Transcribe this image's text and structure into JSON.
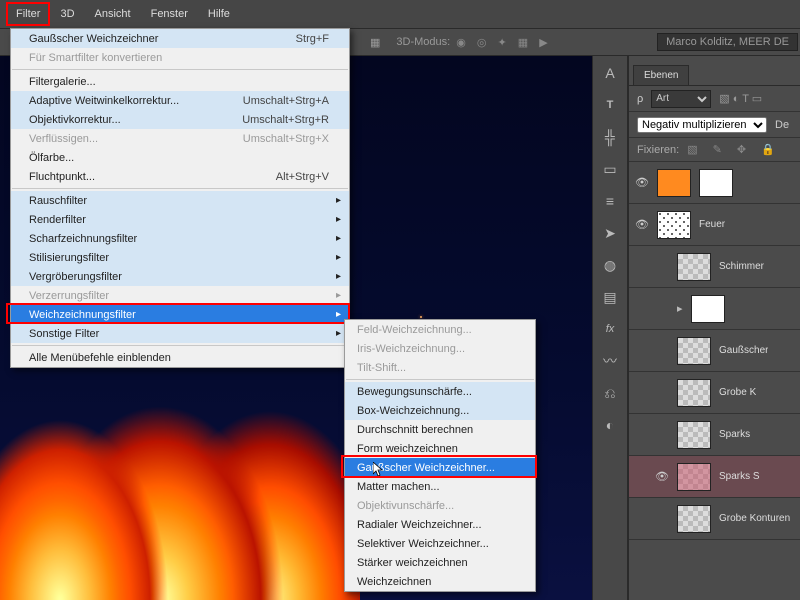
{
  "menubar": {
    "items": [
      "Filter",
      "3D",
      "Ansicht",
      "Fenster",
      "Hilfe"
    ],
    "active_index": 0
  },
  "topstrip": {
    "mode_label": "3D-Modus:",
    "user_tag": "Marco Kolditz, MEER DE"
  },
  "dropdown1": {
    "items": [
      {
        "label": "Gaußscher Weichzeichner",
        "shortcut": "Strg+F",
        "shade": true
      },
      {
        "label": "Für Smartfilter konvertieren",
        "disabled": true
      },
      {
        "sep": true
      },
      {
        "label": "Filtergalerie...",
        "shade": false
      },
      {
        "label": "Adaptive Weitwinkelkorrektur...",
        "shortcut": "Umschalt+Strg+A",
        "shade": true
      },
      {
        "label": "Objektivkorrektur...",
        "shortcut": "Umschalt+Strg+R",
        "shade": true
      },
      {
        "label": "Verflüssigen...",
        "shortcut": "Umschalt+Strg+X",
        "disabled": true
      },
      {
        "label": "Ölfarbe..."
      },
      {
        "label": "Fluchtpunkt...",
        "shortcut": "Alt+Strg+V"
      },
      {
        "sep": true
      },
      {
        "label": "Rauschfilter",
        "shade": true,
        "submenu": true
      },
      {
        "label": "Renderfilter",
        "shade": true,
        "submenu": true
      },
      {
        "label": "Scharfzeichnungsfilter",
        "shade": true,
        "submenu": true
      },
      {
        "label": "Stilisierungsfilter",
        "shade": true,
        "submenu": true
      },
      {
        "label": "Vergröberungsfilter",
        "shade": true,
        "submenu": true
      },
      {
        "label": "Verzerrungsfilter",
        "disabled": true,
        "submenu": true
      },
      {
        "label": "Weichzeichnungsfilter",
        "shade": true,
        "submenu": true,
        "selected": true,
        "highlight": true
      },
      {
        "label": "Sonstige Filter",
        "shade": true,
        "submenu": true
      },
      {
        "sep": true
      },
      {
        "label": "Alle Menübefehle einblenden"
      }
    ]
  },
  "dropdown2": {
    "items": [
      {
        "label": "Feld-Weichzeichnung...",
        "disabled": true
      },
      {
        "label": "Iris-Weichzeichnung...",
        "disabled": true
      },
      {
        "label": "Tilt-Shift...",
        "disabled": true
      },
      {
        "sep": true
      },
      {
        "label": "Bewegungsunschärfe...",
        "shade": true
      },
      {
        "label": "Box-Weichzeichnung...",
        "shade": true
      },
      {
        "label": "Durchschnitt berechnen"
      },
      {
        "label": "Form weichzeichnen"
      },
      {
        "label": "Gaußscher Weichzeichner...",
        "shade": true,
        "selected": true,
        "highlight": true
      },
      {
        "label": "Matter machen..."
      },
      {
        "label": "Objektivunschärfe...",
        "disabled": true
      },
      {
        "label": "Radialer Weichzeichner..."
      },
      {
        "label": "Selektiver Weichzeichner..."
      },
      {
        "label": "Stärker weichzeichnen"
      },
      {
        "label": "Weichzeichnen"
      }
    ]
  },
  "tools": [
    "A",
    "T",
    "ruler",
    "slice",
    "guide",
    "arrow",
    "palette",
    "gradient",
    "fx",
    "brush",
    "clone",
    "dodge"
  ],
  "layers_panel": {
    "tab": "Ebenen",
    "kind": "Art",
    "blend": "Negativ multiplizieren",
    "label_pin": "Fixieren:",
    "label_dev": "De",
    "layers": [
      {
        "eye": true,
        "indent": 0,
        "thumb": "orange",
        "mask": true,
        "name": ""
      },
      {
        "eye": true,
        "indent": 0,
        "thumb": "white-sparks",
        "mask": false,
        "name": "Feuer"
      },
      {
        "eye": false,
        "indent": 1,
        "thumb": "checker",
        "name": "Schimmer"
      },
      {
        "eye": false,
        "indent": 1,
        "thumb": "white",
        "arrow": true,
        "name": ""
      },
      {
        "eye": false,
        "indent": 1,
        "thumb": "checker",
        "name": "Gaußscher"
      },
      {
        "eye": false,
        "indent": 1,
        "thumb": "checker",
        "name": "Grobe K"
      },
      {
        "eye": false,
        "indent": 1,
        "thumb": "checker",
        "name": "Sparks"
      },
      {
        "eye": true,
        "indent": 1,
        "thumb": "checker-pink",
        "name": "Sparks S",
        "selected": true
      },
      {
        "eye": false,
        "indent": 1,
        "thumb": "checker",
        "name": "Grobe Konturen"
      }
    ]
  }
}
